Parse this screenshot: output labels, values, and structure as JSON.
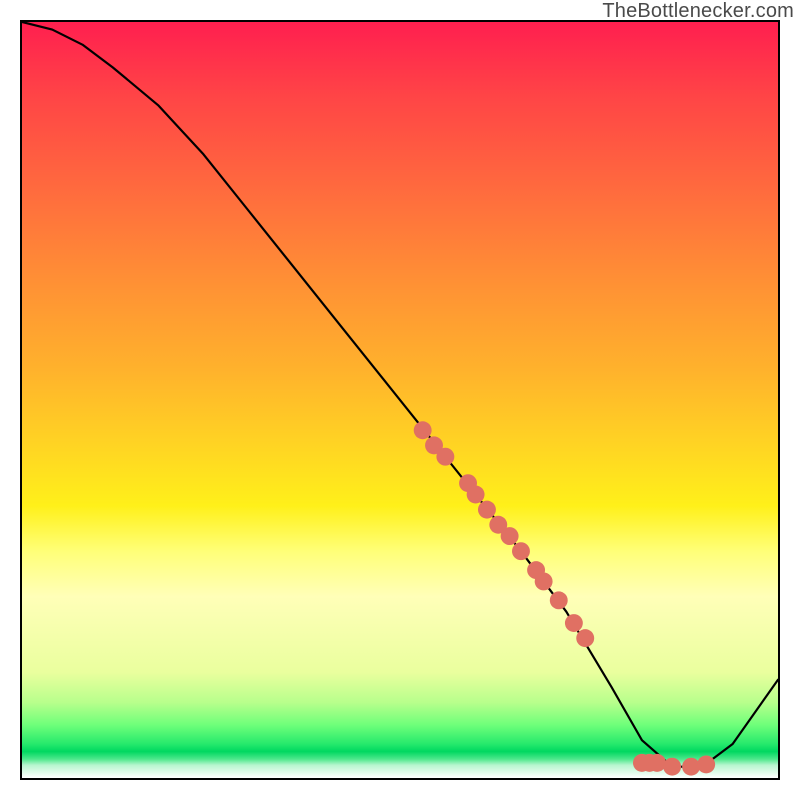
{
  "watermark": "TheBottlenecker.com",
  "chart_data": {
    "type": "line",
    "title": "",
    "xlabel": "",
    "ylabel": "",
    "xlim": [
      0,
      100
    ],
    "ylim": [
      0,
      100
    ],
    "grid": false,
    "legend": false,
    "series": [
      {
        "name": "curve",
        "x": [
          0,
          4,
          8,
          12,
          18,
          24,
          30,
          36,
          42,
          48,
          54,
          60,
          66,
          72,
          78,
          82,
          86,
          90,
          94,
          100
        ],
        "y": [
          100,
          99,
          97,
          94,
          89,
          82.5,
          75,
          67.5,
          60,
          52.5,
          45,
          37.5,
          30,
          22,
          12,
          5,
          1.5,
          1.5,
          4.5,
          13
        ],
        "color": "#000000",
        "width": 2.2
      }
    ],
    "scatter": {
      "name": "points",
      "color": "#e07063",
      "radius": 9,
      "points": [
        {
          "x": 53,
          "y": 46
        },
        {
          "x": 54.5,
          "y": 44
        },
        {
          "x": 56,
          "y": 42.5
        },
        {
          "x": 59,
          "y": 39
        },
        {
          "x": 60,
          "y": 37.5
        },
        {
          "x": 61.5,
          "y": 35.5
        },
        {
          "x": 63,
          "y": 33.5
        },
        {
          "x": 64.5,
          "y": 32
        },
        {
          "x": 66,
          "y": 30
        },
        {
          "x": 68,
          "y": 27.5
        },
        {
          "x": 69,
          "y": 26
        },
        {
          "x": 71,
          "y": 23.5
        },
        {
          "x": 73,
          "y": 20.5
        },
        {
          "x": 74.5,
          "y": 18.5
        },
        {
          "x": 82,
          "y": 2
        },
        {
          "x": 83,
          "y": 2
        },
        {
          "x": 84,
          "y": 2
        },
        {
          "x": 86,
          "y": 1.5
        },
        {
          "x": 88.5,
          "y": 1.5
        },
        {
          "x": 90.5,
          "y": 1.8
        }
      ]
    }
  }
}
